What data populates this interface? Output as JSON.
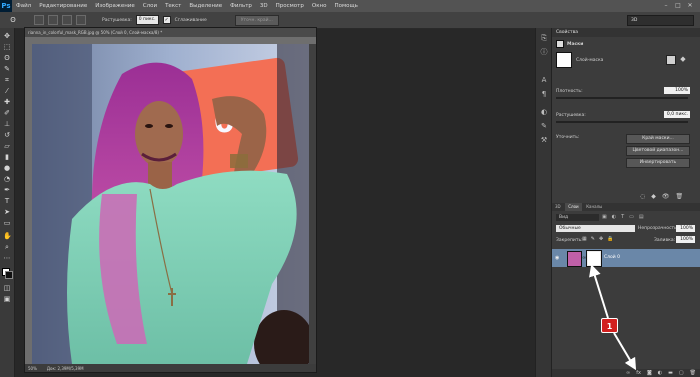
{
  "app": {
    "logo": "Ps"
  },
  "menu": [
    "Файл",
    "Редактирование",
    "Изображение",
    "Слои",
    "Текст",
    "Выделение",
    "Фильтр",
    "3D",
    "Просмотр",
    "Окно",
    "Помощь"
  ],
  "window_controls": [
    "–",
    "□",
    "✕"
  ],
  "options": {
    "feather_label": "Растушевка:",
    "feather_value": "0 пикс.",
    "antialias_label": "Сглаживание",
    "refine_button": "Уточн. край...",
    "workspace_value": "3D"
  },
  "document": {
    "tab_title": "rianna_in_colorful_mask_RGB.jpg @ 50% (Слой 0, Слой-маска/8) *",
    "zoom": "50%",
    "doc_info": "Док: 2,39M/5,39M"
  },
  "properties": {
    "tab_label": "Свойства",
    "section_label": "Маски",
    "mask_type": "Слой-маска",
    "density_label": "Плотность:",
    "density_value": "100%",
    "feather_label": "Растушевка:",
    "feather_value": "0,0 пикс.",
    "refine_label": "Уточнить:",
    "btn_mask_edge": "Край маски...",
    "btn_color_range": "Цветовой диапазон...",
    "btn_invert": "Инвертировать"
  },
  "layers": {
    "tabs": [
      "3D",
      "Слои",
      "Каналы"
    ],
    "active_tab": "Слои",
    "filter_label": "Вид",
    "blend_mode": "Обычные",
    "opacity_label": "Непрозрачность:",
    "opacity_value": "100%",
    "lock_label": "Закрепить:",
    "fill_label": "Заливка:",
    "fill_value": "100%",
    "layer_name": "Слой 0",
    "bottom_icons": [
      "link-icon",
      "fx-icon",
      "add-mask-icon",
      "adjustment-icon",
      "group-icon",
      "new-layer-icon",
      "trash-icon"
    ]
  },
  "annotation": {
    "badge_number": "1"
  },
  "colors": {
    "accent_badge": "#d2201f",
    "layer_selected": "#6a87a8",
    "hair_magenta": "#b03aa6",
    "sweater_mint": "#7fcfb4"
  }
}
